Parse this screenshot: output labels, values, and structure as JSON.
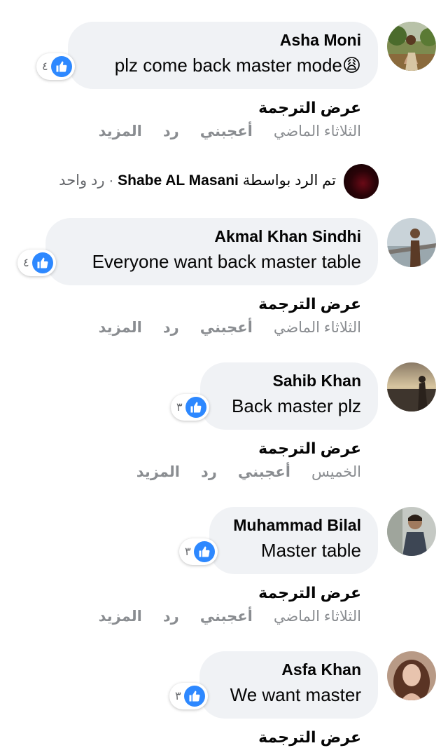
{
  "comments": [
    {
      "author": "Asha Moni",
      "text": "plz come back master mode",
      "emoji": "😩",
      "likes": "٤",
      "translate": "عرض الترجمة",
      "time": "الثلاثاء الماضي",
      "like_label": "أعجبني",
      "reply_label": "رد",
      "more_label": "المزيد"
    },
    {
      "author": "Akmal Khan Sindhi",
      "text": "Everyone want back master table",
      "likes": "٤",
      "translate": "عرض الترجمة",
      "time": "الثلاثاء الماضي",
      "like_label": "أعجبني",
      "reply_label": "رد",
      "more_label": "المزيد"
    },
    {
      "author": "Sahib Khan",
      "text": "Back master plz",
      "likes": "٣",
      "translate": "عرض الترجمة",
      "time": "الخميس",
      "like_label": "أعجبني",
      "reply_label": "رد",
      "more_label": "المزيد"
    },
    {
      "author": "Muhammad Bilal",
      "text": "Master table",
      "likes": "٣",
      "translate": "عرض الترجمة",
      "time": "الثلاثاء الماضي",
      "like_label": "أعجبني",
      "reply_label": "رد",
      "more_label": "المزيد"
    },
    {
      "author": "Asfa Khan",
      "text": "We want master",
      "likes": "٣",
      "translate": "عرض الترجمة"
    }
  ],
  "reply_summary": {
    "prefix": "تم الرد بواسطة",
    "name": "Shabe AL Masani",
    "separator": " · ",
    "count": "رد واحد"
  },
  "colors": {
    "bubble": "#f0f2f5",
    "like_blue": "#2d88ff",
    "muted": "#8a8d91"
  },
  "icons": {
    "like": "thumbs-up-icon"
  }
}
